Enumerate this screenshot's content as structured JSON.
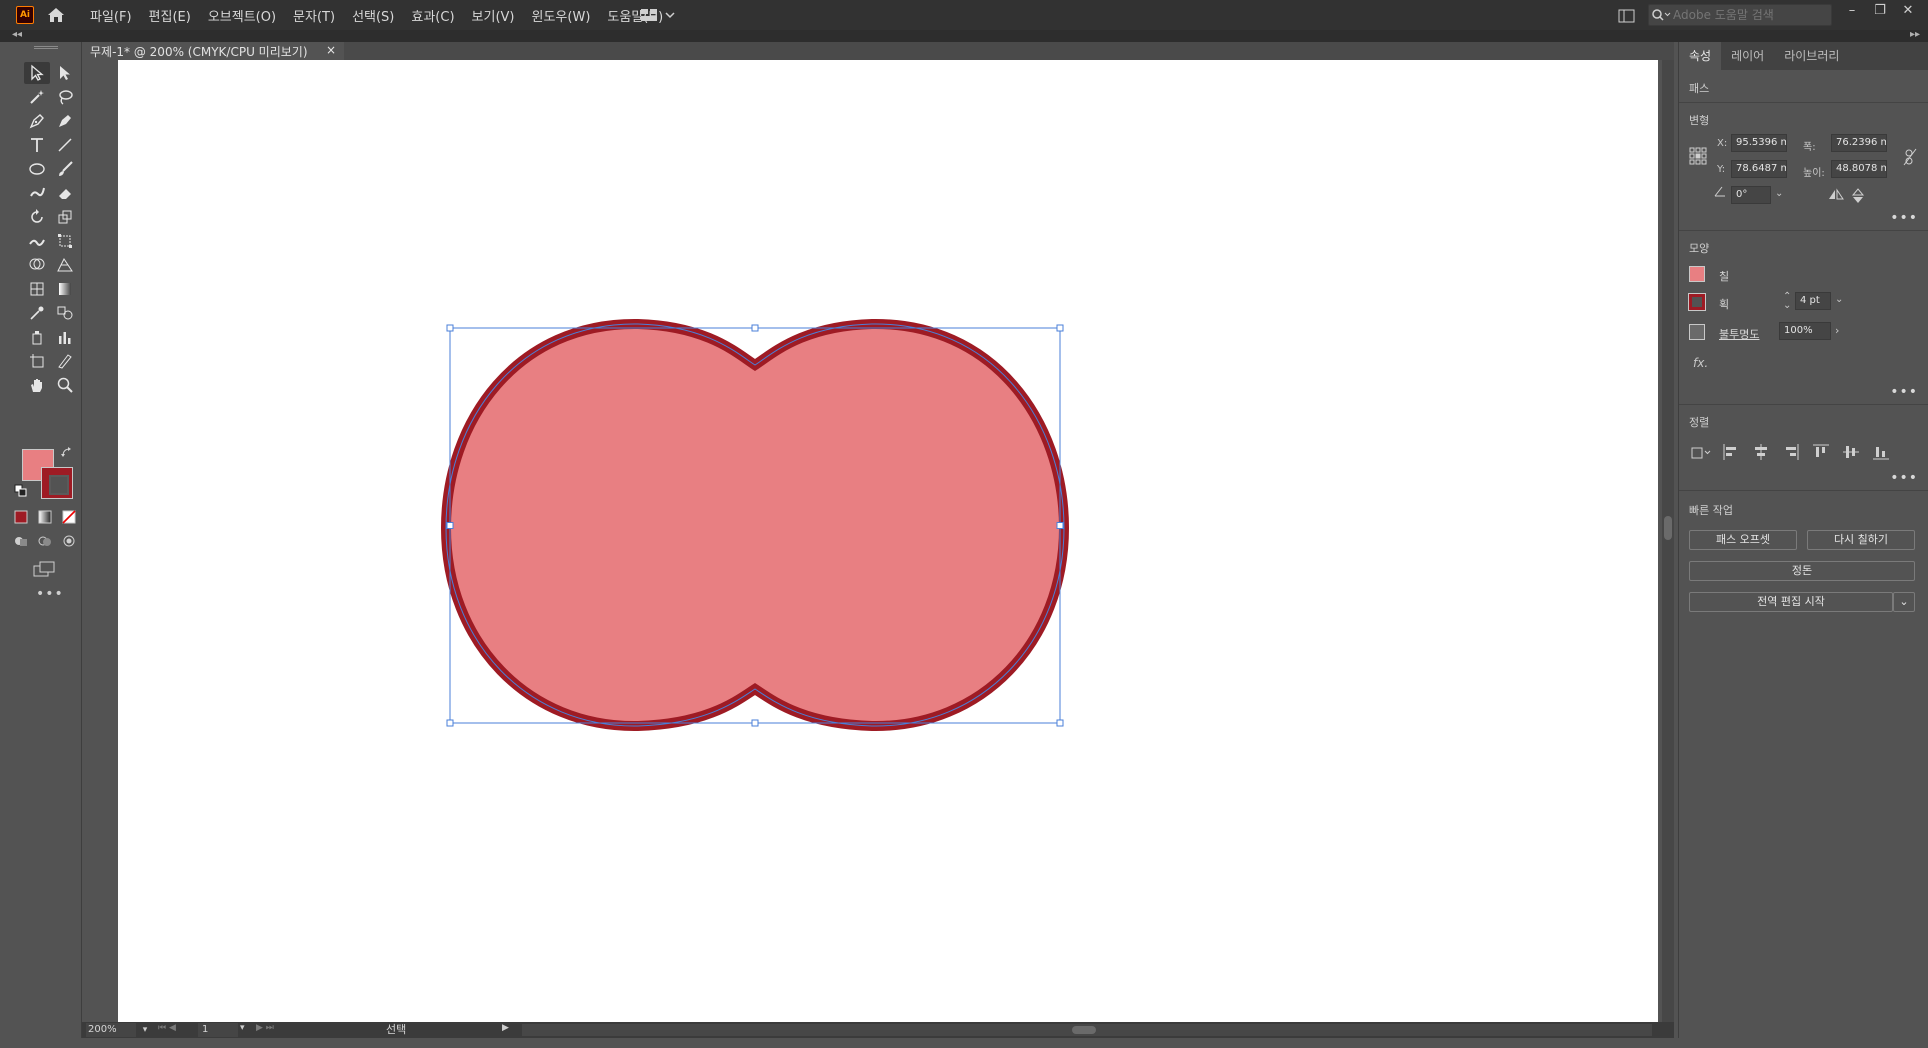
{
  "app": {
    "logo": "Ai",
    "menu": [
      "파일(F)",
      "편집(E)",
      "오브젝트(O)",
      "문자(T)",
      "선택(S)",
      "효과(C)",
      "보기(V)",
      "윈도우(W)",
      "도움말(H)"
    ],
    "help_search_placeholder": "Adobe 도움말 검색",
    "window_buttons": [
      "–",
      "❐",
      "✕"
    ]
  },
  "document": {
    "tab_title": "무제-1* @ 200% (CMYK/CPU 미리보기)",
    "tab_close": "×"
  },
  "artwork": {
    "fill_color": "#e87f82",
    "stroke_color": "#9e1b24",
    "selection_color": "#4a7fd8"
  },
  "statusbar": {
    "zoom": "200%",
    "page": "1",
    "status": "선택"
  },
  "panel": {
    "tabs": [
      "속성",
      "레이어",
      "라이브러리"
    ],
    "object_type": "패스",
    "transform": {
      "title": "변형",
      "x_label": "X:",
      "x": "95.5396 m",
      "y_label": "Y:",
      "y": "78.6487 m",
      "w_label": "폭:",
      "w": "76.2396 m",
      "h_label": "높이:",
      "h": "48.8078 m",
      "angle": "0°"
    },
    "appearance": {
      "title": "모양",
      "fill_label": "칠",
      "stroke_label": "획",
      "stroke_weight": "4 pt",
      "opacity_label": "불투명도",
      "opacity": "100%",
      "fx": "fx."
    },
    "align": {
      "title": "정렬"
    },
    "quick_actions": {
      "title": "빠른 작업",
      "offset_path": "패스 오프셋",
      "recolor": "다시 칠하기",
      "arrange": "정돈",
      "global_edit": "전역 편집 시작"
    },
    "more": "•••"
  },
  "colors": {
    "ui_dark": "#323232",
    "ui_mid": "#535353",
    "fill": "#e87f82",
    "stroke": "#9e1b24"
  }
}
